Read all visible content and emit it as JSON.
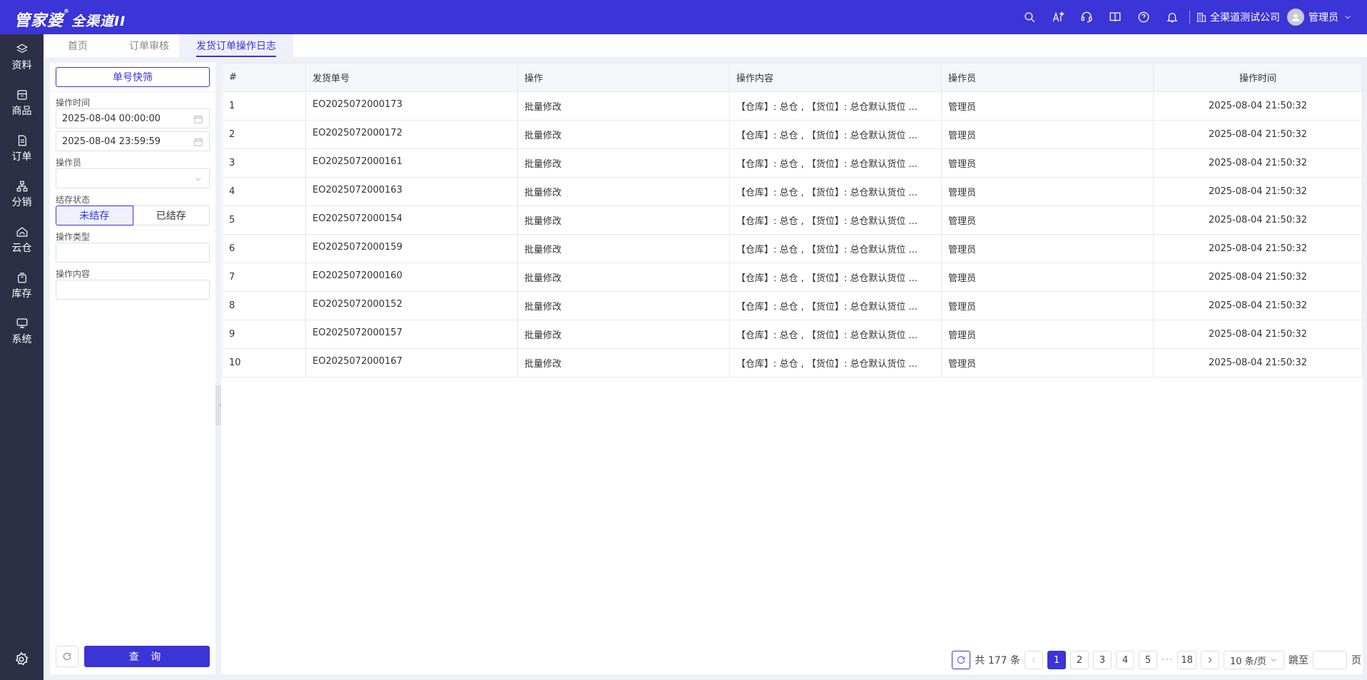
{
  "header": {
    "logo_main": "管家婆",
    "logo_sub": "全渠道II",
    "company": "全渠道测试公司",
    "user": "管理员"
  },
  "sidebar": {
    "items": [
      {
        "label": "资料",
        "icon": "layers-icon"
      },
      {
        "label": "商品",
        "icon": "box-icon"
      },
      {
        "label": "订单",
        "icon": "document-icon"
      },
      {
        "label": "分销",
        "icon": "network-icon"
      },
      {
        "label": "云仓",
        "icon": "cloud-warehouse-icon"
      },
      {
        "label": "库存",
        "icon": "stack-icon"
      },
      {
        "label": "系统",
        "icon": "monitor-icon"
      }
    ]
  },
  "tabs": [
    {
      "label": "首页"
    },
    {
      "label": "订单审核"
    },
    {
      "label": "发货订单操作日志"
    }
  ],
  "filter": {
    "quick_button": "单号快筛",
    "time_label": "操作时间",
    "time_start": "2025-08-04 00:00:00",
    "time_end": "2025-08-04 23:59:59",
    "operator_label": "操作员",
    "status_label": "结存状态",
    "status_options": [
      "未结存",
      "已结存"
    ],
    "type_label": "操作类型",
    "content_label": "操作内容",
    "query_button": "查 询"
  },
  "table": {
    "columns": [
      "#",
      "发货单号",
      "操作",
      "操作内容",
      "操作员",
      "操作时间"
    ],
    "rows": [
      [
        "1",
        "EO2025072000173",
        "批量修改",
        "【仓库】: 总仓 , 【货位】: 总仓默认货位 ...",
        "管理员",
        "2025-08-04 21:50:32"
      ],
      [
        "2",
        "EO2025072000172",
        "批量修改",
        "【仓库】: 总仓 , 【货位】: 总仓默认货位 ...",
        "管理员",
        "2025-08-04 21:50:32"
      ],
      [
        "3",
        "EO2025072000161",
        "批量修改",
        "【仓库】: 总仓 , 【货位】: 总仓默认货位 ...",
        "管理员",
        "2025-08-04 21:50:32"
      ],
      [
        "4",
        "EO2025072000163",
        "批量修改",
        "【仓库】: 总仓 , 【货位】: 总仓默认货位 ...",
        "管理员",
        "2025-08-04 21:50:32"
      ],
      [
        "5",
        "EO2025072000154",
        "批量修改",
        "【仓库】: 总仓 , 【货位】: 总仓默认货位 ...",
        "管理员",
        "2025-08-04 21:50:32"
      ],
      [
        "6",
        "EO2025072000159",
        "批量修改",
        "【仓库】: 总仓 , 【货位】: 总仓默认货位 ...",
        "管理员",
        "2025-08-04 21:50:32"
      ],
      [
        "7",
        "EO2025072000160",
        "批量修改",
        "【仓库】: 总仓 , 【货位】: 总仓默认货位 ...",
        "管理员",
        "2025-08-04 21:50:32"
      ],
      [
        "8",
        "EO2025072000152",
        "批量修改",
        "【仓库】: 总仓 , 【货位】: 总仓默认货位 ...",
        "管理员",
        "2025-08-04 21:50:32"
      ],
      [
        "9",
        "EO2025072000157",
        "批量修改",
        "【仓库】: 总仓 , 【货位】: 总仓默认货位 ...",
        "管理员",
        "2025-08-04 21:50:32"
      ],
      [
        "10",
        "EO2025072000167",
        "批量修改",
        "【仓库】: 总仓 , 【货位】: 总仓默认货位 ...",
        "管理员",
        "2025-08-04 21:50:32"
      ]
    ]
  },
  "pager": {
    "total": "共 177 条",
    "pages": [
      "1",
      "2",
      "3",
      "4",
      "5"
    ],
    "ellipsis": "···",
    "last_page": "18",
    "page_size": "10 条/页",
    "jump_label": "跳至",
    "page_unit": "页"
  },
  "colors": {
    "primary": "#3b34d6",
    "sidebar": "#2c2f45"
  }
}
